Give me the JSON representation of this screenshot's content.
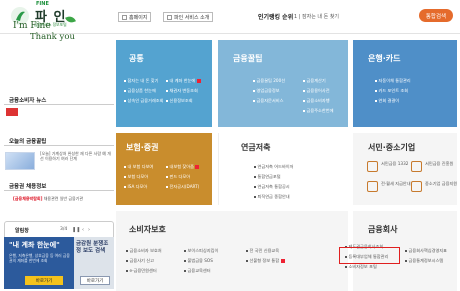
{
  "header": {
    "brand_top": "FINE",
    "brand_title": "파 인",
    "brand_sub": "금융서비스 정보포털",
    "btn_home": "홈페이지",
    "btn_intro": "파인 서비스 소개",
    "rank_label": "인기랭킹 순위",
    "rank_text": "1 | 잠자는 내 돈 찾기",
    "search_btn": "통합검색"
  },
  "left": {
    "im_fine": "I'm Fine",
    "thank_you": "Thank you",
    "news_title": "금융소비자 뉴스",
    "tip_title": "오늘의 금융꿀팁",
    "tip_text": "[오늘] 가계상처 완성한 재 다른 사람 예 개선 이용하기 여러 단계",
    "hire_title": "금융권 채용정보",
    "hire_red": "[금융채용박람회]",
    "hire_text": "채용관련 일반 금융기관",
    "alarm_title": "알림창",
    "alarm_page": "3/4",
    "banner_title": "\"내 계좌 한눈에\"",
    "banner_desc": "은행, 저축은행, 상호금융 등 여러 금융권의 계좌를 한번에 조회",
    "banner_btn": "바로가기",
    "banner2_title": "금감원 분쟁조정 보도 검색",
    "banner2_btn": "바로가기"
  },
  "tiles": {
    "gong": {
      "title": "공통",
      "items": [
        "잠자는 내 돈 찾기",
        "내 계좌 한눈에",
        "금융상품 한눈에",
        "채권자 변동조회",
        "상속인 금융거래조회",
        "신용정보조회"
      ]
    },
    "tip": {
      "title": "금융꿀팁",
      "items": [
        "금융꿀팁 200선",
        "금융계산기",
        "영업금융정보",
        "금융용어사전",
        "금융자문서비스",
        "금융소비자행",
        "금융주소한번에"
      ]
    },
    "bank": {
      "title": "은행·카드",
      "items": [
        "자동이체 통합관리",
        "카드 포인트 조회",
        "연회 결결이"
      ]
    },
    "ins": {
      "title": "보험·증권",
      "items": [
        "내 보험 다보여",
        "내보험 찾아줌",
        "보험 다모아",
        "펀드 다모아",
        "ISA 다모아",
        "전자공시(DART)"
      ]
    },
    "pension": {
      "title": "연금저축",
      "items": [
        "연금저축 어드바이저",
        "통합연금포털",
        "연금저축 통합공시",
        "퇴직연금 종합안내"
      ]
    },
    "smb": {
      "title": "서민·중소기업",
      "items": [
        "서민금융 1332",
        "서민금융 진흥원",
        "전·월세 지급안내",
        "중소기업 금융지원"
      ]
    },
    "consumer": {
      "title": "소비자보호",
      "items": [
        "금융소비자 보호처",
        "보이스피싱지킴이",
        "전 국민 신용교육",
        "금융사기 신고",
        "불법금융 SOS",
        "선불형 정보 통합",
        "e-금융민원센터",
        "금융교육센터"
      ]
    },
    "company": {
      "title": "금융회사",
      "items": [
        "제도권금융회사조회",
        "금융회사핵심경영지표",
        "등록대부업체 통합관리",
        "금융통계정보시스템",
        "소비자정보 포털"
      ]
    }
  },
  "colors": {
    "accent": "#e56b2c",
    "gong": "#54a3d0",
    "tip": "#83b7d9",
    "bank": "#4f8fc8",
    "ins": "#c98d2d",
    "highlight": "#e02020"
  }
}
